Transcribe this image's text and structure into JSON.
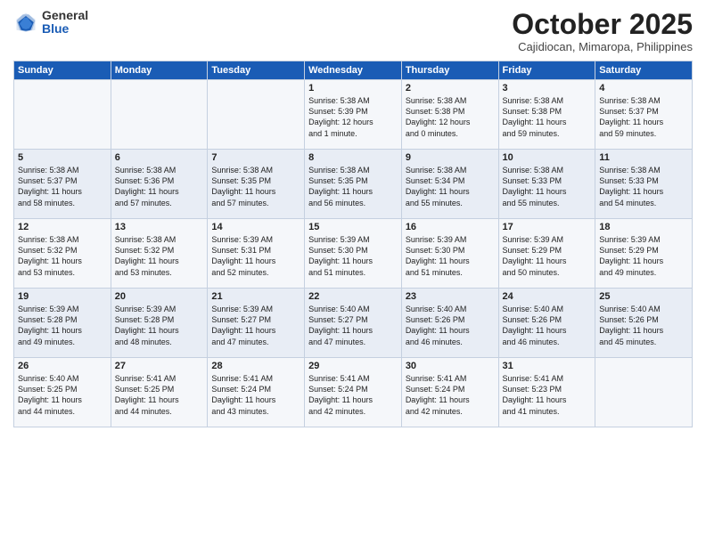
{
  "logo": {
    "general": "General",
    "blue": "Blue"
  },
  "header": {
    "month": "October 2025",
    "location": "Cajidiocan, Mimaropa, Philippines"
  },
  "weekdays": [
    "Sunday",
    "Monday",
    "Tuesday",
    "Wednesday",
    "Thursday",
    "Friday",
    "Saturday"
  ],
  "weeks": [
    [
      {
        "day": "",
        "lines": []
      },
      {
        "day": "",
        "lines": []
      },
      {
        "day": "",
        "lines": []
      },
      {
        "day": "1",
        "lines": [
          "Sunrise: 5:38 AM",
          "Sunset: 5:39 PM",
          "Daylight: 12 hours",
          "and 1 minute."
        ]
      },
      {
        "day": "2",
        "lines": [
          "Sunrise: 5:38 AM",
          "Sunset: 5:38 PM",
          "Daylight: 12 hours",
          "and 0 minutes."
        ]
      },
      {
        "day": "3",
        "lines": [
          "Sunrise: 5:38 AM",
          "Sunset: 5:38 PM",
          "Daylight: 11 hours",
          "and 59 minutes."
        ]
      },
      {
        "day": "4",
        "lines": [
          "Sunrise: 5:38 AM",
          "Sunset: 5:37 PM",
          "Daylight: 11 hours",
          "and 59 minutes."
        ]
      }
    ],
    [
      {
        "day": "5",
        "lines": [
          "Sunrise: 5:38 AM",
          "Sunset: 5:37 PM",
          "Daylight: 11 hours",
          "and 58 minutes."
        ]
      },
      {
        "day": "6",
        "lines": [
          "Sunrise: 5:38 AM",
          "Sunset: 5:36 PM",
          "Daylight: 11 hours",
          "and 57 minutes."
        ]
      },
      {
        "day": "7",
        "lines": [
          "Sunrise: 5:38 AM",
          "Sunset: 5:35 PM",
          "Daylight: 11 hours",
          "and 57 minutes."
        ]
      },
      {
        "day": "8",
        "lines": [
          "Sunrise: 5:38 AM",
          "Sunset: 5:35 PM",
          "Daylight: 11 hours",
          "and 56 minutes."
        ]
      },
      {
        "day": "9",
        "lines": [
          "Sunrise: 5:38 AM",
          "Sunset: 5:34 PM",
          "Daylight: 11 hours",
          "and 55 minutes."
        ]
      },
      {
        "day": "10",
        "lines": [
          "Sunrise: 5:38 AM",
          "Sunset: 5:33 PM",
          "Daylight: 11 hours",
          "and 55 minutes."
        ]
      },
      {
        "day": "11",
        "lines": [
          "Sunrise: 5:38 AM",
          "Sunset: 5:33 PM",
          "Daylight: 11 hours",
          "and 54 minutes."
        ]
      }
    ],
    [
      {
        "day": "12",
        "lines": [
          "Sunrise: 5:38 AM",
          "Sunset: 5:32 PM",
          "Daylight: 11 hours",
          "and 53 minutes."
        ]
      },
      {
        "day": "13",
        "lines": [
          "Sunrise: 5:38 AM",
          "Sunset: 5:32 PM",
          "Daylight: 11 hours",
          "and 53 minutes."
        ]
      },
      {
        "day": "14",
        "lines": [
          "Sunrise: 5:39 AM",
          "Sunset: 5:31 PM",
          "Daylight: 11 hours",
          "and 52 minutes."
        ]
      },
      {
        "day": "15",
        "lines": [
          "Sunrise: 5:39 AM",
          "Sunset: 5:30 PM",
          "Daylight: 11 hours",
          "and 51 minutes."
        ]
      },
      {
        "day": "16",
        "lines": [
          "Sunrise: 5:39 AM",
          "Sunset: 5:30 PM",
          "Daylight: 11 hours",
          "and 51 minutes."
        ]
      },
      {
        "day": "17",
        "lines": [
          "Sunrise: 5:39 AM",
          "Sunset: 5:29 PM",
          "Daylight: 11 hours",
          "and 50 minutes."
        ]
      },
      {
        "day": "18",
        "lines": [
          "Sunrise: 5:39 AM",
          "Sunset: 5:29 PM",
          "Daylight: 11 hours",
          "and 49 minutes."
        ]
      }
    ],
    [
      {
        "day": "19",
        "lines": [
          "Sunrise: 5:39 AM",
          "Sunset: 5:28 PM",
          "Daylight: 11 hours",
          "and 49 minutes."
        ]
      },
      {
        "day": "20",
        "lines": [
          "Sunrise: 5:39 AM",
          "Sunset: 5:28 PM",
          "Daylight: 11 hours",
          "and 48 minutes."
        ]
      },
      {
        "day": "21",
        "lines": [
          "Sunrise: 5:39 AM",
          "Sunset: 5:27 PM",
          "Daylight: 11 hours",
          "and 47 minutes."
        ]
      },
      {
        "day": "22",
        "lines": [
          "Sunrise: 5:40 AM",
          "Sunset: 5:27 PM",
          "Daylight: 11 hours",
          "and 47 minutes."
        ]
      },
      {
        "day": "23",
        "lines": [
          "Sunrise: 5:40 AM",
          "Sunset: 5:26 PM",
          "Daylight: 11 hours",
          "and 46 minutes."
        ]
      },
      {
        "day": "24",
        "lines": [
          "Sunrise: 5:40 AM",
          "Sunset: 5:26 PM",
          "Daylight: 11 hours",
          "and 46 minutes."
        ]
      },
      {
        "day": "25",
        "lines": [
          "Sunrise: 5:40 AM",
          "Sunset: 5:26 PM",
          "Daylight: 11 hours",
          "and 45 minutes."
        ]
      }
    ],
    [
      {
        "day": "26",
        "lines": [
          "Sunrise: 5:40 AM",
          "Sunset: 5:25 PM",
          "Daylight: 11 hours",
          "and 44 minutes."
        ]
      },
      {
        "day": "27",
        "lines": [
          "Sunrise: 5:41 AM",
          "Sunset: 5:25 PM",
          "Daylight: 11 hours",
          "and 44 minutes."
        ]
      },
      {
        "day": "28",
        "lines": [
          "Sunrise: 5:41 AM",
          "Sunset: 5:24 PM",
          "Daylight: 11 hours",
          "and 43 minutes."
        ]
      },
      {
        "day": "29",
        "lines": [
          "Sunrise: 5:41 AM",
          "Sunset: 5:24 PM",
          "Daylight: 11 hours",
          "and 42 minutes."
        ]
      },
      {
        "day": "30",
        "lines": [
          "Sunrise: 5:41 AM",
          "Sunset: 5:24 PM",
          "Daylight: 11 hours",
          "and 42 minutes."
        ]
      },
      {
        "day": "31",
        "lines": [
          "Sunrise: 5:41 AM",
          "Sunset: 5:23 PM",
          "Daylight: 11 hours",
          "and 41 minutes."
        ]
      },
      {
        "day": "",
        "lines": []
      }
    ]
  ]
}
